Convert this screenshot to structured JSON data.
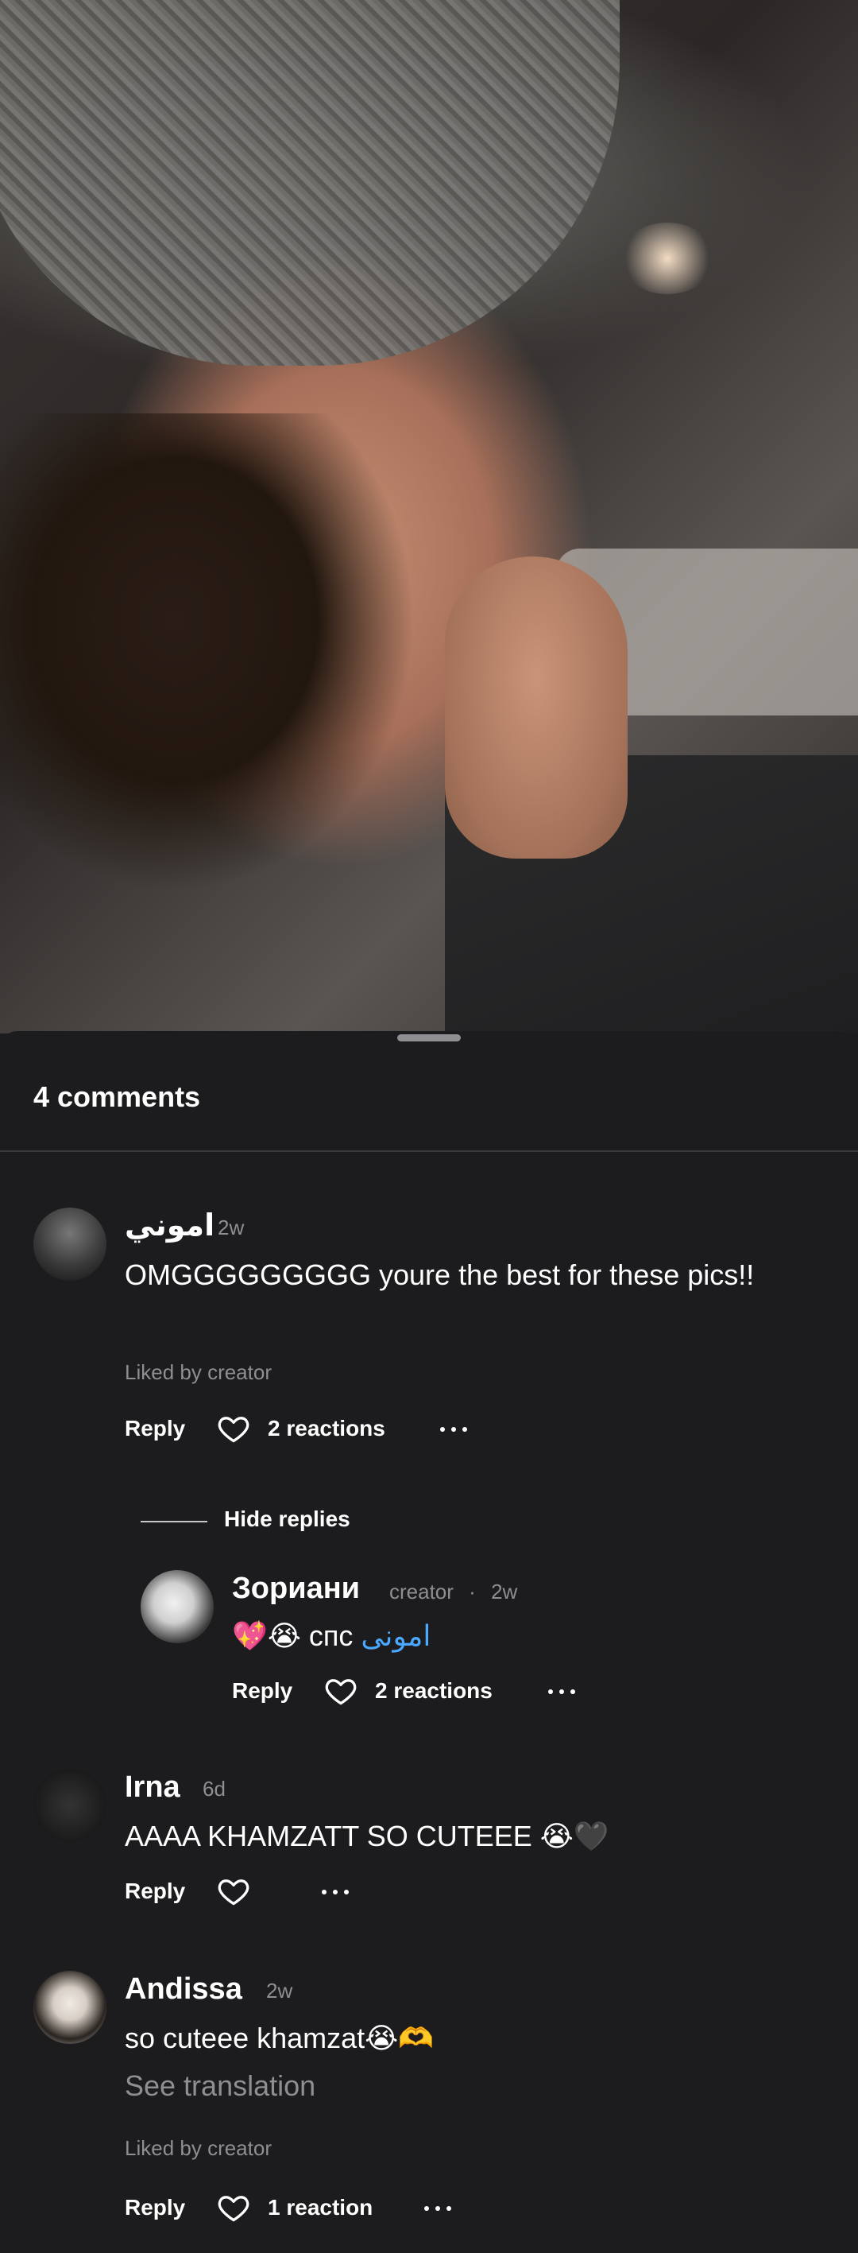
{
  "sheet": {
    "title": "4 comments"
  },
  "comments": [
    {
      "name": "اموني",
      "time": "2w",
      "text": "OMGGGGGGGGG youre the best for these pics!!",
      "liked": "Liked by creator",
      "reply": "Reply",
      "reactions": "2 reactions",
      "hide_replies": "Hide replies",
      "replies": [
        {
          "name": "Зориани",
          "tag": "creator",
          "dot": "·",
          "time": "2w",
          "emoji": "💖😭",
          "text": "спс",
          "mention": "امونی",
          "reply": "Reply",
          "reactions": "2 reactions"
        }
      ]
    },
    {
      "name": "Irna",
      "time": "6d",
      "text": "AAAA KHAMZATT SO CUTEEE",
      "emoji": "😭🖤",
      "reply": "Reply"
    },
    {
      "name": "Andissa",
      "time": "2w",
      "text": "so cuteee khamzat",
      "emoji": "😭🫶",
      "see_translation": "See translation",
      "liked": "Liked by creator",
      "reply": "Reply",
      "reactions": "1 reaction"
    }
  ],
  "colors": {
    "background": "#1c1c1e",
    "muted": "#8e8e93",
    "mention": "#4aa8ff"
  }
}
